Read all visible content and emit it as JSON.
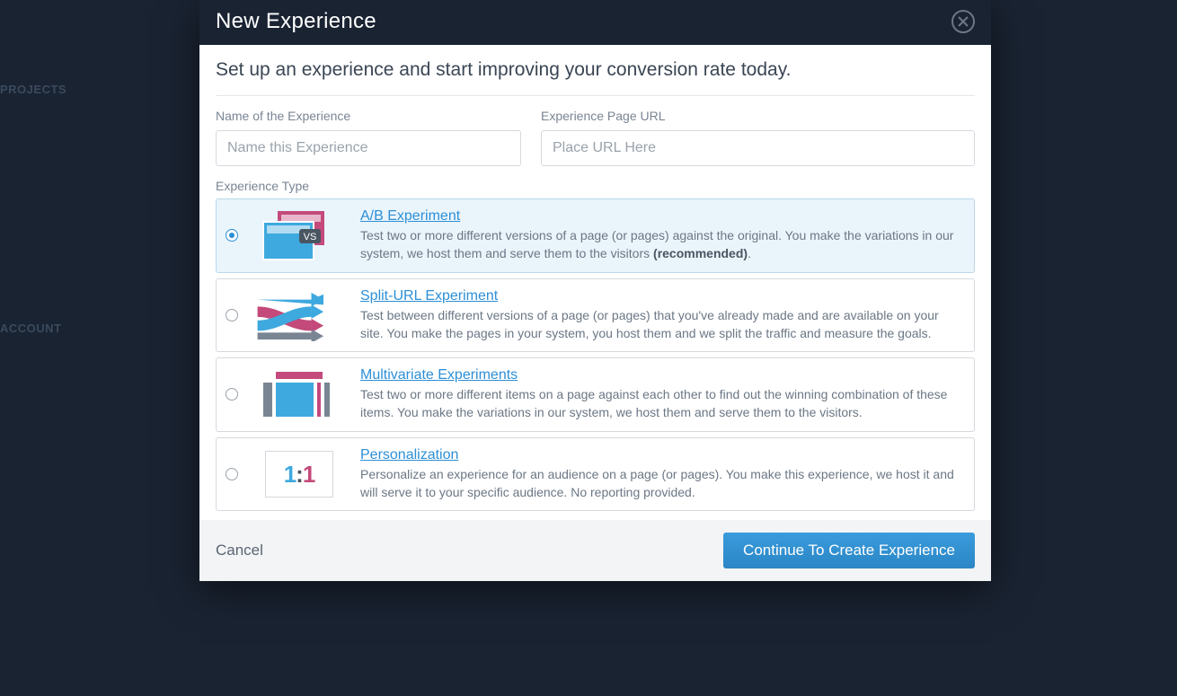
{
  "header": {
    "title": "New Experience"
  },
  "subtitle": "Set up an experience and start improving your conversion rate today.",
  "form": {
    "name_label": "Name of the Experience",
    "name_placeholder": "Name this Experience",
    "url_label": "Experience Page URL",
    "url_placeholder": "Place URL Here",
    "type_label": "Experience Type"
  },
  "options": [
    {
      "title": "A/B Experiment",
      "desc_pre": "Test two or more different versions of a page (or pages) against the original. You make the variations in our system, we host them and serve them to the visitors ",
      "desc_bold": "(recommended)",
      "desc_post": ".",
      "selected": true
    },
    {
      "title": "Split-URL Experiment",
      "desc_pre": "Test between different versions of a page (or pages) that you've already made and are available on your site. You make the pages in your system, you host them and we split the traffic and measure the goals.",
      "desc_bold": "",
      "desc_post": "",
      "selected": false
    },
    {
      "title": "Multivariate Experiments",
      "desc_pre": "Test two or more different items on a page against each other to find out the winning combination of these items. You make the variations in our system, we host them and serve them to the visitors.",
      "desc_bold": "",
      "desc_post": "",
      "selected": false
    },
    {
      "title": "Personalization",
      "desc_pre": "Personalize an experience for an audience on a page (or pages). You make this experience, we host it and will serve it to your specific audience. No reporting provided.",
      "desc_bold": "",
      "desc_post": "",
      "selected": false
    }
  ],
  "footer": {
    "cancel": "Cancel",
    "continue": "Continue To Create Experience"
  },
  "bg": {
    "projects": "PROJECTS",
    "account": "ACCOUNT"
  }
}
